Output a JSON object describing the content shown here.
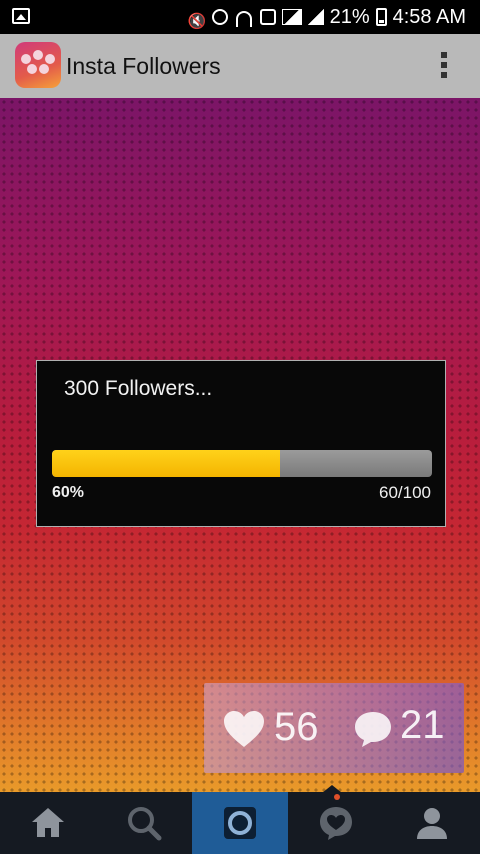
{
  "status_bar": {
    "battery_percent": "21%",
    "time": "4:58 AM",
    "icons": [
      "gallery-icon",
      "mute-icon",
      "alarm-icon",
      "wifi-icon",
      "message-icon",
      "signal-icon",
      "battery-icon"
    ]
  },
  "app_bar": {
    "title": "Insta Followers"
  },
  "dialog": {
    "message": "300 Followers...",
    "progress_percent_label": "60%",
    "progress_count_label": "60/100",
    "progress_value": 60,
    "progress_max": 100
  },
  "stats": {
    "likes": "56",
    "comments": "21"
  },
  "bottom_nav": {
    "items": [
      "home-icon",
      "search-icon",
      "camera-icon",
      "activity-icon",
      "profile-icon"
    ],
    "active": "camera-icon"
  },
  "colors": {
    "progress_fill": "#f4b400",
    "progress_track": "#8a8a8a",
    "nav_active": "#1f5c97",
    "nav_background": "#151a22"
  }
}
